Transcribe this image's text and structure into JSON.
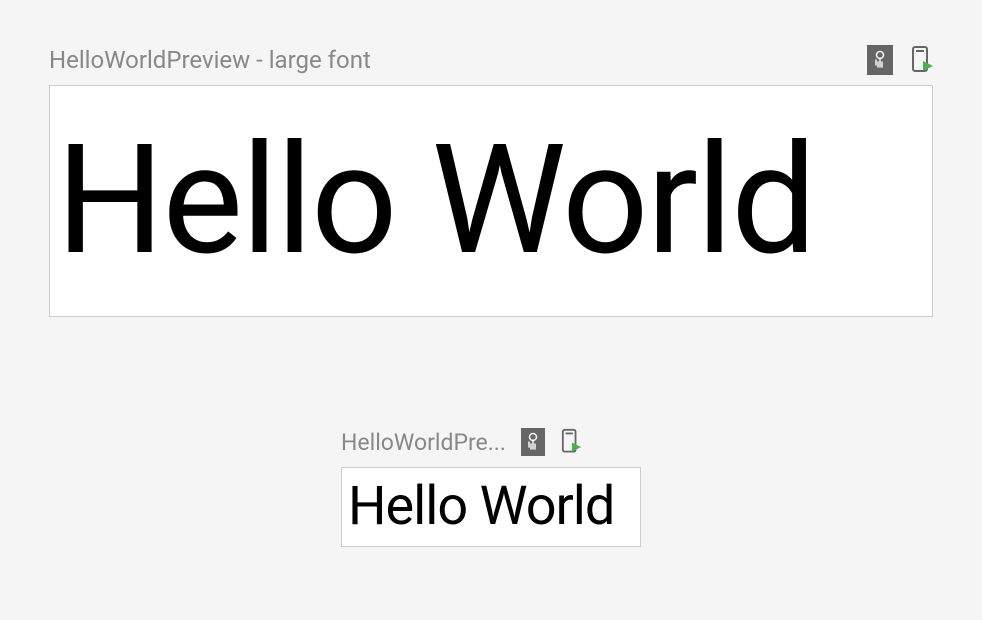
{
  "previews": {
    "large": {
      "label": "HelloWorldPreview - large font",
      "content": "Hello World"
    },
    "small": {
      "label": "HelloWorldPre...",
      "content": "Hello World"
    }
  },
  "icons": {
    "interactive": "interactive-mode-icon",
    "deploy": "deploy-preview-icon"
  }
}
